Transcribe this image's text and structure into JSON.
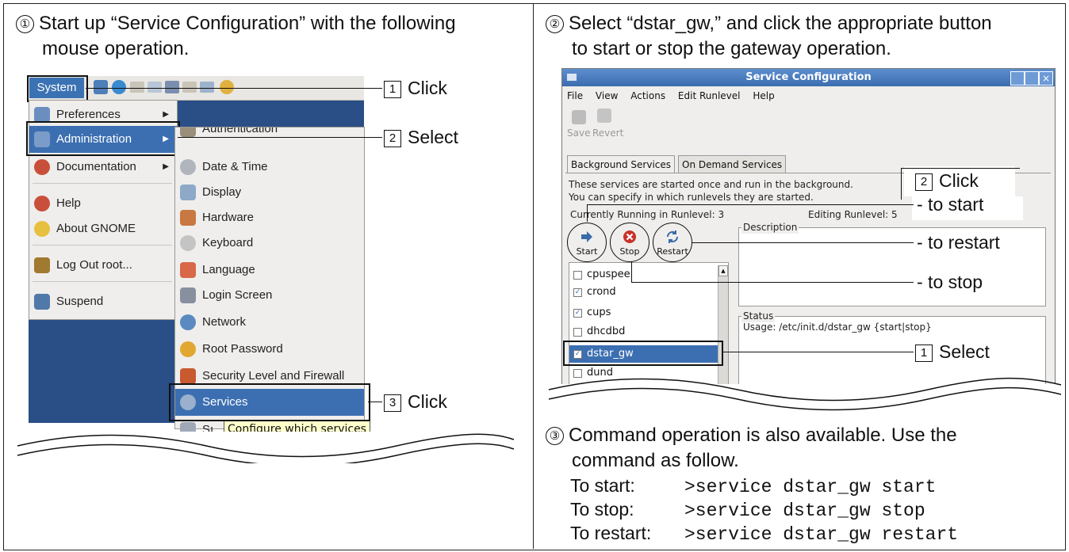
{
  "step1": {
    "num": "①",
    "line1": "Start up “Service Configuration” with the following",
    "line2": "mouse operation."
  },
  "step2": {
    "num": "②",
    "line1": "Select “dstar_gw,” and click the appropriate button",
    "line2": "to start or stop the gateway operation."
  },
  "step3": {
    "num": "③",
    "line1": "Command operation is also available. Use the",
    "line2": "command as follow."
  },
  "commands": [
    {
      "label": "To start:",
      "cmd": ">service dstar_gw start"
    },
    {
      "label": "To stop:",
      "cmd": ">service dstar_gw stop"
    },
    {
      "label": "To restart:",
      "cmd": ">service dstar_gw restart"
    }
  ],
  "left_callouts": [
    {
      "num": "1",
      "text": "Click"
    },
    {
      "num": "2",
      "text": "Select"
    },
    {
      "num": "3",
      "text": "Click"
    }
  ],
  "right_callouts": {
    "click_num": "2",
    "click_text": "Click",
    "to_start": "- to start",
    "to_restart": "- to restart",
    "to_stop": "- to stop",
    "select_num": "1",
    "select_text": "Select"
  },
  "gnome": {
    "system_label": "System",
    "menu_items": [
      "Preferences",
      "Administration",
      "Documentation",
      "Help",
      "About GNOME",
      "Log Out root...",
      "Suspend"
    ],
    "admin_items": [
      "Authentication",
      "Date & Time",
      "Display",
      "Hardware",
      "Keyboard",
      "Language",
      "Login Screen",
      "Network",
      "Root Password",
      "Security Level and Firewall",
      "Services",
      "Sı"
    ],
    "tooltip": "Configure which services"
  },
  "service_window": {
    "title": "Service Configuration",
    "menu": [
      "File",
      "View",
      "Actions",
      "Edit Runlevel",
      "Help"
    ],
    "toolbar": [
      "Save",
      "Revert"
    ],
    "tabs": [
      "Background Services",
      "On Demand Services"
    ],
    "info_line1": "These services are started once and run in the background.",
    "info_line2": "You can specify in which runlevels they are started.",
    "running": "Currently Running in Runlevel: 3",
    "editing": "Editing Runlevel: 5",
    "buttons": [
      "Start",
      "Stop",
      "Restart"
    ],
    "description_label": "Description",
    "status_label": "Status",
    "status_text": "Usage: /etc/init.d/dstar_gw {start|stop}",
    "services": [
      {
        "name": "cpuspee",
        "checked": false
      },
      {
        "name": "crond",
        "checked": true
      },
      {
        "name": "cups",
        "checked": true
      },
      {
        "name": "dhcdbd",
        "checked": false
      },
      {
        "name": "dstar_gw",
        "checked": true
      },
      {
        "name": "dund",
        "checked": false
      }
    ]
  },
  "colors": {
    "desktop": "#2a4e86",
    "selection": "#3c6fb1",
    "titlebar": "#4a7cc0"
  }
}
